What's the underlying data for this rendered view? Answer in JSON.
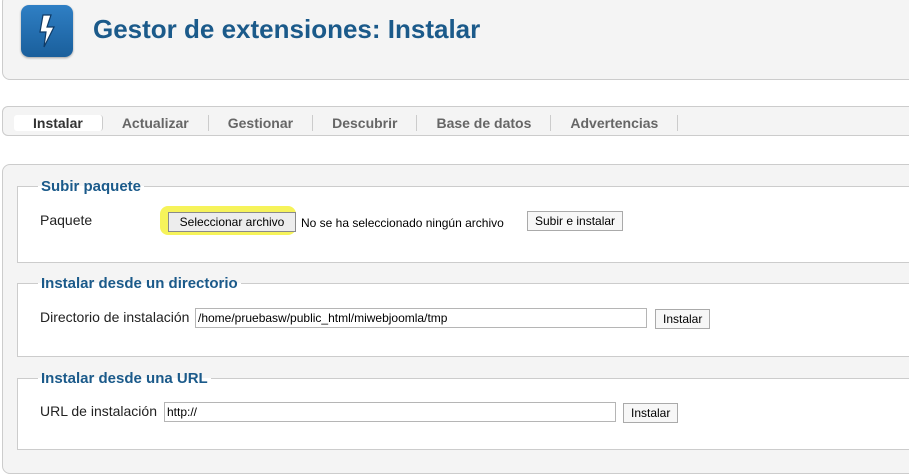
{
  "header": {
    "title": "Gestor de extensiones: Instalar",
    "logo_icon": "lightning-bolt-icon"
  },
  "tabs": [
    {
      "label": "Instalar",
      "active": true
    },
    {
      "label": "Actualizar"
    },
    {
      "label": "Gestionar"
    },
    {
      "label": "Descubrir"
    },
    {
      "label": "Base de datos"
    },
    {
      "label": "Advertencias"
    }
  ],
  "upload": {
    "legend": "Subir paquete",
    "label": "Paquete",
    "file_button": "Seleccionar archivo",
    "file_status": "No se ha seleccionado ningún archivo",
    "submit": "Subir e instalar"
  },
  "directory": {
    "legend": "Instalar desde un directorio",
    "label": "Directorio de instalación",
    "value": "/home/pruebasw/public_html/miwebjoomla/tmp",
    "submit": "Instalar"
  },
  "url": {
    "legend": "Instalar desde una URL",
    "label": "URL de instalación",
    "value": "http://",
    "submit": "Instalar"
  },
  "colors": {
    "accent": "#1b5a8a",
    "highlight": "#f6f35a"
  }
}
